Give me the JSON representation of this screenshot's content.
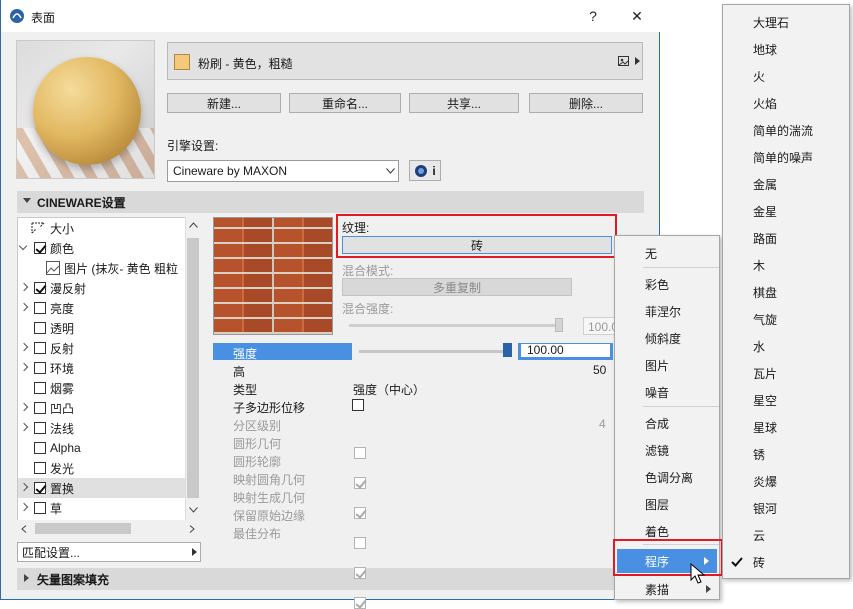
{
  "window": {
    "title": "表面",
    "help_label": "?",
    "close_label": "✕"
  },
  "material": {
    "name": "粉刷 - 黄色，粗糙",
    "swatch_color": "#f6c97a"
  },
  "buttons": {
    "new": "新建...",
    "rename": "重命名...",
    "share": "共享...",
    "delete": "删除..."
  },
  "engine": {
    "label": "引擎设置:",
    "value": "Cineware by MAXON",
    "info": "i"
  },
  "cineware": {
    "header": "CINEWARE设置"
  },
  "tree": {
    "items": [
      {
        "label": "大小"
      },
      {
        "label": "颜色"
      },
      {
        "label": "图片 (抹灰- 黄色 粗粒"
      },
      {
        "label": "漫反射"
      },
      {
        "label": "亮度"
      },
      {
        "label": "透明"
      },
      {
        "label": "反射"
      },
      {
        "label": "环境"
      },
      {
        "label": "烟雾"
      },
      {
        "label": "凹凸"
      },
      {
        "label": "法线"
      },
      {
        "label": "Alpha"
      },
      {
        "label": "发光"
      },
      {
        "label": "置换"
      },
      {
        "label": "草"
      }
    ]
  },
  "match_settings": "匹配设置...",
  "vector_hatch": "矢量图案填充",
  "texture": {
    "label": "纹理:",
    "value": "砖",
    "blend_mode_label": "混合模式:",
    "blend_mode_value": "多重复制",
    "blend_strength_label": "混合强度:",
    "blend_strength_value": "100.0"
  },
  "params": {
    "strength_label": "强度",
    "strength_value": "100.00",
    "height_label": "高",
    "height_value": "50",
    "type_label": "类型",
    "type_value": "强度（中心）",
    "subpoly_label": "子多边形位移",
    "subdiv_label": "分区级别",
    "subdiv_value": "4",
    "round_geo_label": "圆形几何",
    "round_contour_label": "圆形轮廓",
    "map_round_label": "映射圆角几何",
    "map_result_label": "映射生成几何",
    "keep_edges_label": "保留原始边缘",
    "best_dist_label": "最佳分布"
  },
  "menu1": {
    "items": [
      "无",
      "彩色",
      "菲涅尔",
      "倾斜度",
      "图片",
      "噪音",
      "合成",
      "滤镜",
      "色调分离",
      "图层",
      "着色",
      "程序",
      "素描"
    ]
  },
  "menu2": {
    "items": [
      "大理石",
      "地球",
      "火",
      "火焰",
      "简单的湍流",
      "简单的噪声",
      "金属",
      "金星",
      "路面",
      "木",
      "棋盘",
      "气旋",
      "水",
      "瓦片",
      "星空",
      "星球",
      "锈",
      "炎爆",
      "银河",
      "云",
      "砖"
    ],
    "checked": "砖"
  }
}
